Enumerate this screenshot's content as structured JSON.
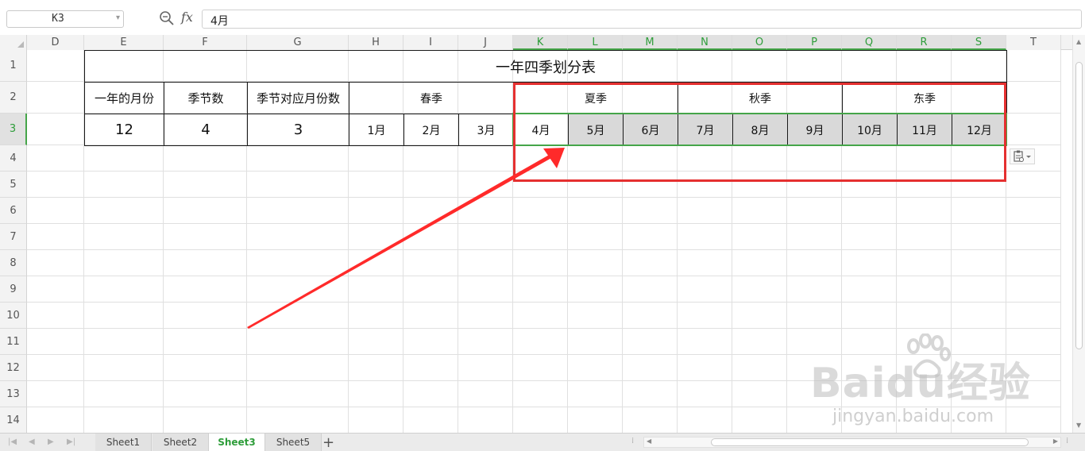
{
  "formula_bar": {
    "cell_ref": "K3",
    "fx_label": "fx",
    "formula_value": "4月"
  },
  "columns": [
    "D",
    "E",
    "F",
    "G",
    "H",
    "I",
    "J",
    "K",
    "L",
    "M",
    "N",
    "O",
    "P",
    "Q",
    "R",
    "S",
    "T"
  ],
  "selected_columns": [
    "K",
    "L",
    "M",
    "N",
    "O",
    "P",
    "Q",
    "R",
    "S"
  ],
  "rows": [
    "1",
    "2",
    "3",
    "4",
    "5",
    "6",
    "7",
    "8",
    "9",
    "10",
    "11",
    "12",
    "13",
    "14"
  ],
  "selected_row": "3",
  "table": {
    "title": "一年四季划分表",
    "labels": [
      "一年的月份",
      "季节数",
      "季节对应月份数"
    ],
    "values": [
      "12",
      "4",
      "3"
    ],
    "seasons": [
      "春季",
      "夏季",
      "秋季",
      "东季"
    ],
    "months": [
      "1月",
      "2月",
      "3月",
      "4月",
      "5月",
      "6月",
      "7月",
      "8月",
      "9月",
      "10月",
      "11月",
      "12月"
    ]
  },
  "sheet_tabs": [
    "Sheet1",
    "Sheet2",
    "Sheet3",
    "Sheet5"
  ],
  "active_sheet": "Sheet3",
  "watermark": {
    "main": "Baidu经验",
    "sub": "jingyan.baidu.com"
  },
  "colors": {
    "selection": "#45a549",
    "annotation_red": "#e53030",
    "highlight_fill": "#d9d9d9"
  },
  "icons": [
    "zoom-formula-icon",
    "paste-options-icon",
    "add-sheet-icon"
  ]
}
